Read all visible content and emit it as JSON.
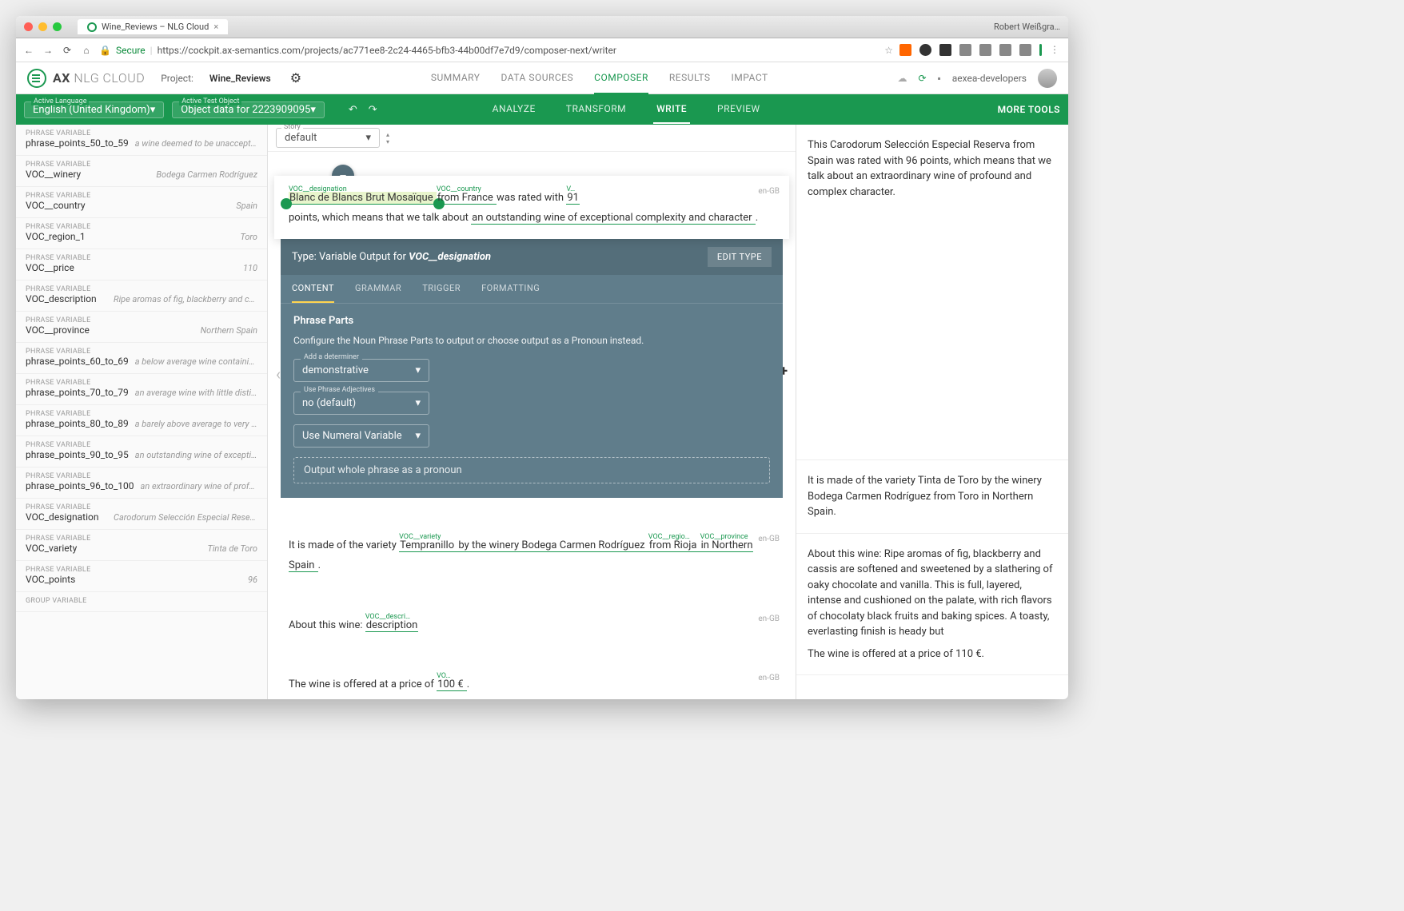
{
  "browser": {
    "tab_title": "Wine_Reviews – NLG Cloud",
    "user": "Robert Weißgra…",
    "secure": "Secure",
    "url": "https://cockpit.ax-semantics.com/projects/ac771ee8-2c24-4465-bfb3-44b00df7e7d9/composer-next/writer"
  },
  "header": {
    "brand_a": "AX",
    "brand_b": "NLG CLOUD",
    "project_label": "Project:",
    "project_name": "Wine_Reviews",
    "nav": [
      "SUMMARY",
      "DATA SOURCES",
      "COMPOSER",
      "RESULTS",
      "IMPACT"
    ],
    "nav_active": 2,
    "team": "aexea-developers"
  },
  "greenbar": {
    "lang_label": "Active Language",
    "lang_value": "English (United Kingdom)",
    "obj_label": "Active Test Object",
    "obj_value": "Object data for 2223909095",
    "subnav": [
      "ANALYZE",
      "TRANSFORM",
      "WRITE",
      "PREVIEW"
    ],
    "subnav_active": 2,
    "more": "MORE TOOLS"
  },
  "sidebar": [
    {
      "type": "PHRASE VARIABLE",
      "name": "phrase_points_50_to_59",
      "value": "a wine deemed to be unacceptable"
    },
    {
      "type": "PHRASE VARIABLE",
      "name": "VOC__winery",
      "value": "Bodega Carmen Rodríguez"
    },
    {
      "type": "PHRASE VARIABLE",
      "name": "VOC__country",
      "value": "Spain"
    },
    {
      "type": "PHRASE VARIABLE",
      "name": "VOC_region_1",
      "value": "Toro"
    },
    {
      "type": "PHRASE VARIABLE",
      "name": "VOC__price",
      "value": "110"
    },
    {
      "type": "PHRASE VARIABLE",
      "name": "VOC_description",
      "value": "Ripe aromas of fig, blackberry and cassis are soften…"
    },
    {
      "type": "PHRASE VARIABLE",
      "name": "VOC__province",
      "value": "Northern Spain"
    },
    {
      "type": "PHRASE VARIABLE",
      "name": "phrase_points_60_to_69",
      "value": "a below average wine containing noticeable d…"
    },
    {
      "type": "PHRASE VARIABLE",
      "name": "phrase_points_70_to_79",
      "value": "an average wine with little distinction except t…"
    },
    {
      "type": "PHRASE VARIABLE",
      "name": "phrase_points_80_to_89",
      "value": "a barely above average to very good wine"
    },
    {
      "type": "PHRASE VARIABLE",
      "name": "phrase_points_90_to_95",
      "value": "an outstanding wine of exceptional complexit…"
    },
    {
      "type": "PHRASE VARIABLE",
      "name": "phrase_points_96_to_100",
      "value": "an extraordinary wine of profound and com…"
    },
    {
      "type": "PHRASE VARIABLE",
      "name": "VOC_designation",
      "value": "Carodorum Selección Especial Reserva"
    },
    {
      "type": "PHRASE VARIABLE",
      "name": "VOC_variety",
      "value": "Tinta de Toro"
    },
    {
      "type": "PHRASE VARIABLE",
      "name": "VOC_points",
      "value": "96"
    },
    {
      "type": "GROUP VARIABLE",
      "name": "",
      "value": ""
    }
  ],
  "story": {
    "label": "Story",
    "value": "default"
  },
  "sentence1": {
    "lang": "en-GB",
    "label_designation": "VOC__designation",
    "tok_designation": "Blanc de Blancs Brut Mosaïque",
    "label_country": "VOC__country",
    "tok_country": "from France",
    "txt_rated": " was rated with ",
    "label_v": "V…",
    "tok_points": "91",
    "txt_points": "points, which means that we talk about ",
    "tok_phrase": "an outstanding wine of exceptional complexity and character ",
    "txt_dot": "."
  },
  "editor": {
    "head_pre": "Type: Variable Output for ",
    "head_var": "VOC__designation",
    "edit_type": "EDIT TYPE",
    "tabs": [
      "CONTENT",
      "GRAMMAR",
      "TRIGGER",
      "FORMATTING"
    ],
    "tabs_active": 0,
    "section": "Phrase Parts",
    "desc": "Configure the Noun Phrase Parts to output or choose output as a Pronoun instead.",
    "f1_label": "Add a determiner",
    "f1_value": "demonstrative",
    "f2_label": "Use Phrase Adjectives",
    "f2_value": "no (default)",
    "f3_value": "Use Numeral Variable",
    "pronoun": "Output whole phrase as a pronoun"
  },
  "sentence2": {
    "lang": "en-GB",
    "txt1": "It is made of the variety ",
    "label_variety": "VOC__variety",
    "tok_variety": "Tempranillo",
    "tok_winery": " by the winery Bodega Carmen Rodríguez ",
    "label_region": "VOC__regio…",
    "tok_region": "from Rioja",
    "label_province": "VOC__province",
    "tok_province": " in Northern Spain ",
    "txt_dot": "."
  },
  "sentence3": {
    "lang": "en-GB",
    "txt1": "About this wine: ",
    "label_desc": "VOC__descri…",
    "tok_desc": "description"
  },
  "sentence4": {
    "lang": "en-GB",
    "txt1": "The wine is offered at a price of ",
    "label_vo": "VO…",
    "tok_price": "100  € ",
    "txt_dot": "."
  },
  "preview": {
    "p1": "This Carodorum Selección Especial Reserva from Spain was rated with 96 points, which means that we talk about an extraordinary wine of profound and complex character.",
    "p2": "It is made of the variety Tinta de Toro by the winery Bodega Carmen Rodríguez from Toro in Northern Spain.",
    "p3": "About this wine: Ripe aromas of fig, blackberry and cassis are softened and sweetened by a slathering of oaky chocolate and vanilla. This is full, layered, intense and cushioned on the palate, with rich flavors of chocolaty black fruits and baking spices. A toasty, everlasting finish is heady but",
    "p4": "The wine is offered at a price of 110 €."
  }
}
